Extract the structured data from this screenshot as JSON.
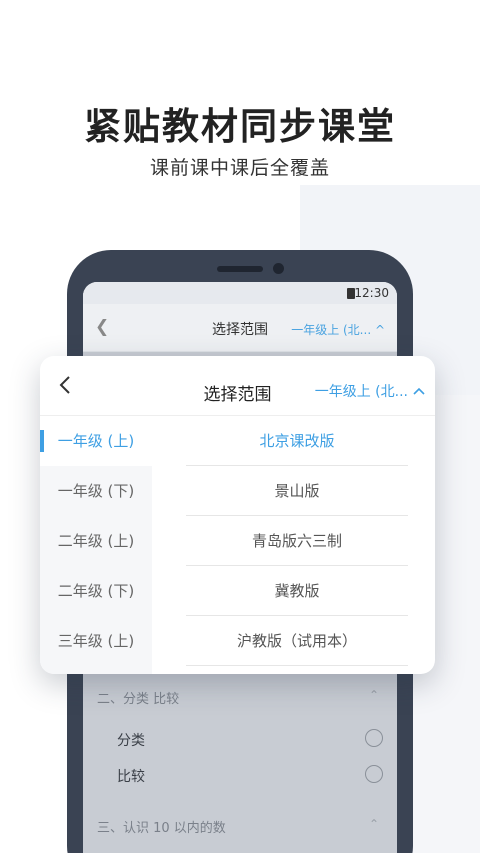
{
  "promo": {
    "headline": "紧贴教材同步课堂",
    "subline": "课前课中课后全覆盖"
  },
  "status_bar": {
    "time": "12:30"
  },
  "screen": {
    "title": "选择范围",
    "grade_selector": "一年级上 (北... ^",
    "sections": [
      {
        "label": "二、分类  比较",
        "items": [
          "分类",
          "比较"
        ]
      },
      {
        "label": "三、认识 10 以内的数",
        "items": []
      }
    ]
  },
  "popup": {
    "title": "选择范围",
    "grade_selector": "一年级上 (北...",
    "grades": [
      "一年级 (上)",
      "一年级 (下)",
      "二年级 (上)",
      "二年级 (下)",
      "三年级 (上)"
    ],
    "selected_grade_index": 0,
    "editions": [
      "北京课改版",
      "景山版",
      "青岛版六三制",
      "冀教版",
      "沪教版（试用本）"
    ],
    "selected_edition_index": 0
  },
  "colors": {
    "accent": "#3e9fe3",
    "phone_frame": "#3a4353"
  }
}
